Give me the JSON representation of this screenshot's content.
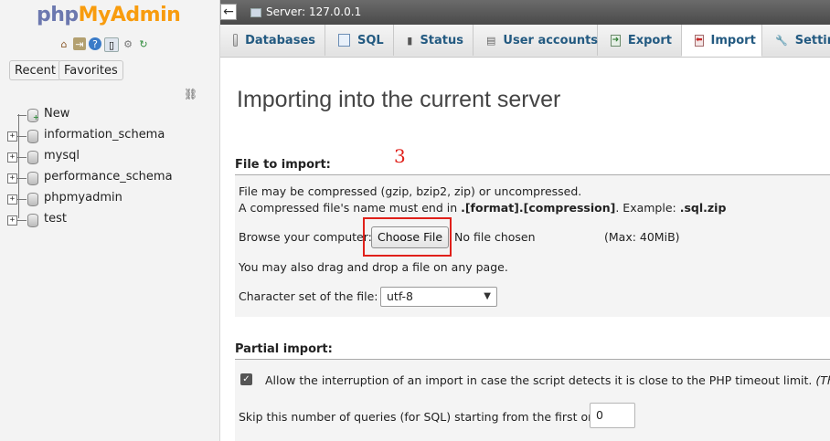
{
  "nav": {
    "logo_php": "php",
    "logo_myadmin": "MyAdmin",
    "icons": [
      "home-icon",
      "logout-icon",
      "help-icon",
      "docs-icon",
      "settings-icon",
      "reload-icon"
    ],
    "recent_label": "Recent",
    "favorites_label": "Favorites",
    "tree": [
      {
        "label": "New",
        "type": "new"
      },
      {
        "label": "information_schema",
        "type": "db"
      },
      {
        "label": "mysql",
        "type": "db"
      },
      {
        "label": "performance_schema",
        "type": "db"
      },
      {
        "label": "phpmyadmin",
        "type": "db"
      },
      {
        "label": "test",
        "type": "db"
      }
    ]
  },
  "topbar": {
    "server_label": "Server: 127.0.0.1"
  },
  "tabs": [
    {
      "label": "Databases",
      "icon": "database-icon"
    },
    {
      "label": "SQL",
      "icon": "sql-icon"
    },
    {
      "label": "Status",
      "icon": "status-chart-icon"
    },
    {
      "label": "User accounts",
      "icon": "user-accounts-icon"
    },
    {
      "label": "Export",
      "icon": "export-icon"
    },
    {
      "label": "Import",
      "icon": "import-icon",
      "active": true
    },
    {
      "label": "Settin",
      "icon": "settings-wrench-icon"
    }
  ],
  "main": {
    "title": "Importing into the current server",
    "annotation": "3",
    "file_section": {
      "title": "File to import:",
      "line1": "File may be compressed (gzip, bzip2, zip) or uncompressed.",
      "line2_prefix": "A compressed file's name must end in ",
      "line2_format": ".[format].[compression]",
      "line2_mid": ". Example: ",
      "line2_example": ".sql.zip",
      "browse_label": "Browse your computer:",
      "choose_file_label": "Choose File",
      "no_file_label": "No file chosen",
      "max_label": "(Max: 40MiB)",
      "drag_label": "You may also drag and drop a file on any page.",
      "charset_label": "Character set of the file:",
      "charset_value": "utf-8"
    },
    "partial_section": {
      "title": "Partial import:",
      "allow_interrupt_label": "Allow the interruption of an import in case the script detects it is close to the PHP timeout limit.",
      "allow_interrupt_note": "(This might",
      "allow_interrupt_checked": true,
      "skip_label": "Skip this number of queries (for SQL) starting from the first one:",
      "skip_value": "0"
    }
  },
  "colors": {
    "accent_red": "#e0201a",
    "tab_text": "#235a81",
    "logo_blue": "#6c78af",
    "logo_orange": "#f89c0e"
  }
}
